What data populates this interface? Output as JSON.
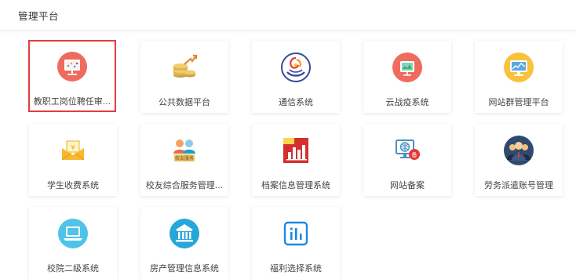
{
  "header": {
    "title": "管理平台"
  },
  "apps": [
    {
      "label": "教职工岗位聘任审...",
      "icon": "presentation-board-icon",
      "selected": true
    },
    {
      "label": "公共数据平台",
      "icon": "coins-growth-icon"
    },
    {
      "label": "通信系统",
      "icon": "communication-logo-icon"
    },
    {
      "label": "云战疫系统",
      "icon": "cloud-epidemic-icon"
    },
    {
      "label": "网站群管理平台",
      "icon": "website-monitor-icon"
    },
    {
      "label": "学生收费系统",
      "icon": "envelope-payment-icon"
    },
    {
      "label": "校友综合服务管理...",
      "icon": "alumni-service-icon",
      "badge": "校友服务"
    },
    {
      "label": "档案信息管理系统",
      "icon": "archive-chart-icon"
    },
    {
      "label": "网站备案",
      "icon": "website-filing-icon",
      "badge": "备"
    },
    {
      "label": "劳务派遣账号管理",
      "icon": "staff-group-icon"
    },
    {
      "label": "校院二级系统",
      "icon": "laptop-icon"
    },
    {
      "label": "房产管理信息系统",
      "icon": "building-icon"
    },
    {
      "label": "福利选择系统",
      "icon": "bar-chart-icon"
    }
  ]
}
